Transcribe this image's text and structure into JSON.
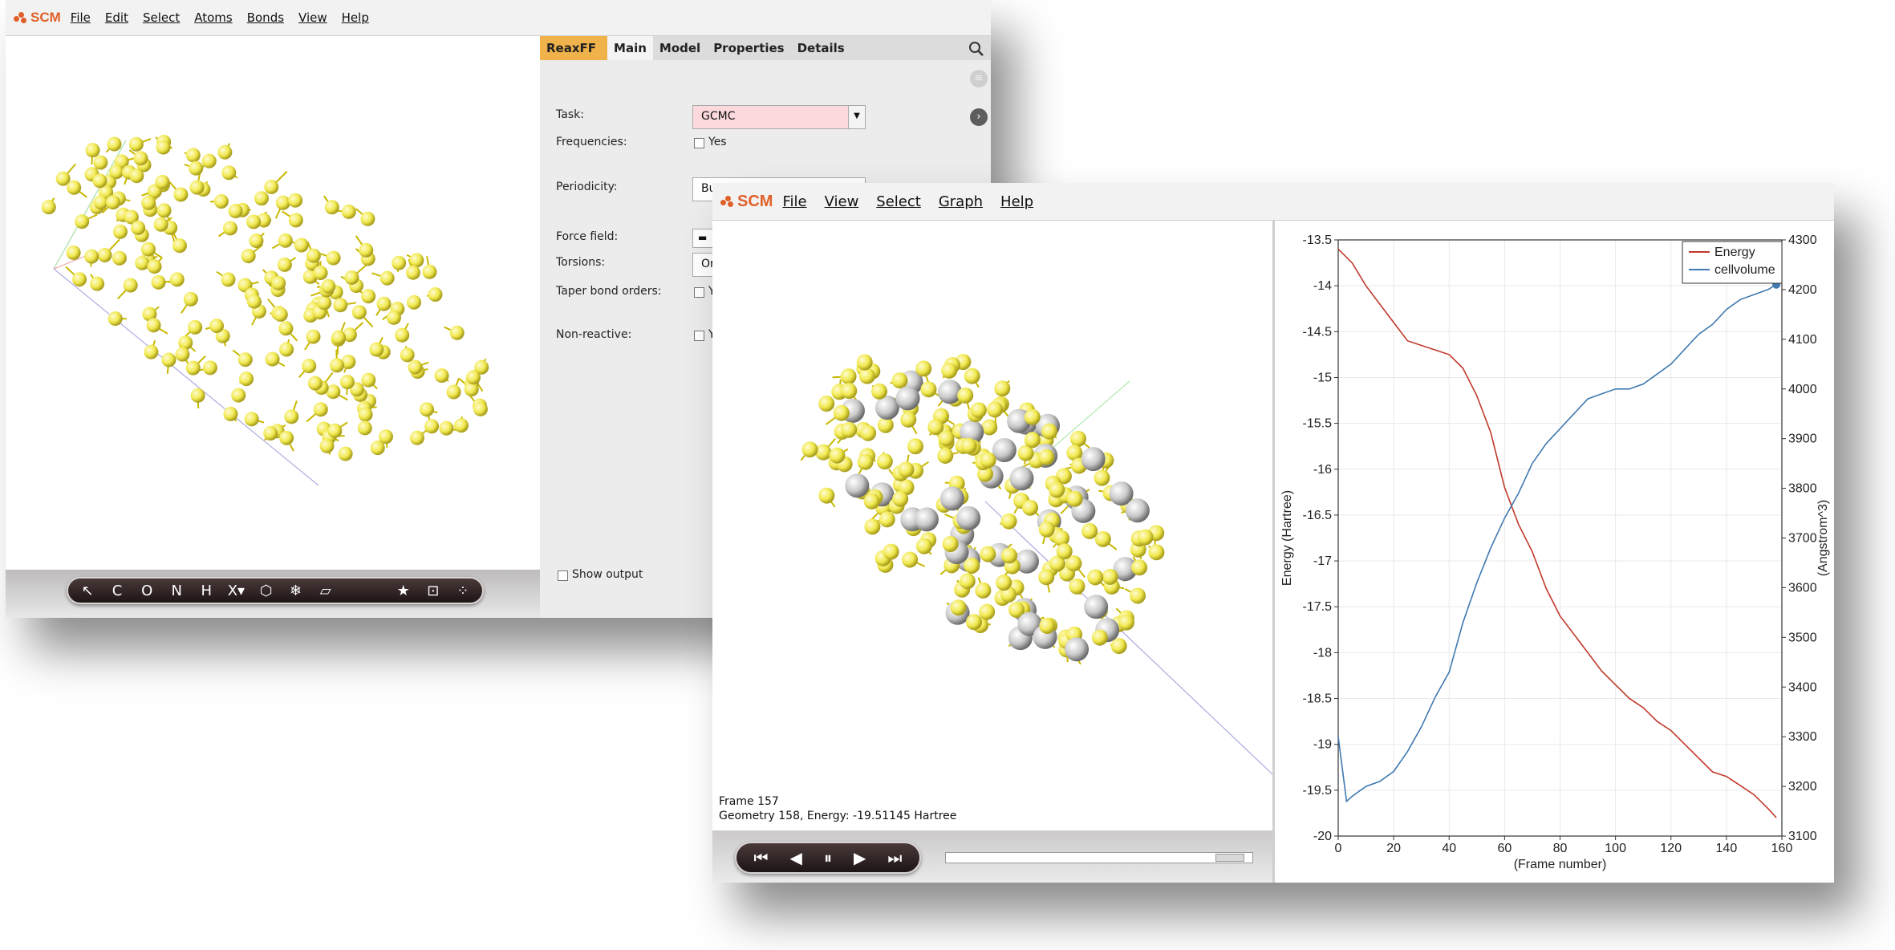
{
  "window1": {
    "logo_text": "SCM",
    "menu": [
      "File",
      "Edit",
      "Select",
      "Atoms",
      "Bonds",
      "View",
      "Help"
    ],
    "toolbar": {
      "tools": [
        {
          "name": "select-tool",
          "glyph": "↖"
        },
        {
          "name": "carbon-tool",
          "glyph": "C"
        },
        {
          "name": "oxygen-tool",
          "glyph": "O"
        },
        {
          "name": "nitrogen-tool",
          "glyph": "N"
        },
        {
          "name": "hydrogen-tool",
          "glyph": "H"
        },
        {
          "name": "halogen-tool",
          "glyph": "X▾"
        },
        {
          "name": "ring-tool",
          "glyph": "⬡"
        },
        {
          "name": "snowflake-tool",
          "glyph": "❄"
        },
        {
          "name": "plane-tool",
          "glyph": "▱"
        },
        {
          "name": "favorite-tool",
          "glyph": "★"
        },
        {
          "name": "region-tool",
          "glyph": "⊡"
        },
        {
          "name": "cluster-tool",
          "glyph": "⁘"
        }
      ]
    },
    "panel": {
      "tabs": [
        "ReaxFF",
        "Main",
        "Model",
        "Properties",
        "Details"
      ],
      "active_tab": "Main",
      "fields": {
        "task_label": "Task:",
        "task_value": "GCMC",
        "frequencies_label": "Frequencies:",
        "frequencies_check": "Yes",
        "periodicity_label": "Periodicity:",
        "periodicity_value": "Bu",
        "force_field_label": "Force field:",
        "torsions_label": "Torsions:",
        "torsions_value": "Or",
        "taper_label": "Taper bond orders:",
        "taper_check": "Ye",
        "nonreactive_label": "Non-reactive:",
        "nonreactive_check": "Ye"
      },
      "show_output_label": "Show output"
    }
  },
  "window2": {
    "logo_text": "SCM",
    "menu": [
      "File",
      "View",
      "Select",
      "Graph",
      "Help"
    ],
    "frame_text": "Frame 157",
    "geometry_text": "Geometry 158, Energy: -19.51145 Hartree",
    "player": {
      "buttons": [
        {
          "name": "first-frame-button",
          "glyph": "⏮"
        },
        {
          "name": "previous-frame-button",
          "glyph": "◀"
        },
        {
          "name": "pause-button",
          "glyph": "⏸"
        },
        {
          "name": "next-frame-button",
          "glyph": "▶"
        },
        {
          "name": "last-frame-button",
          "glyph": "⏭"
        }
      ],
      "slider_fraction": 0.97
    }
  },
  "colors": {
    "energy": "#c0392b",
    "cellvolume": "#3f79b0",
    "atom_s": "#f1e94f",
    "atom_heavy": "#c9c9c9",
    "tab_accent": "#f0b24a"
  },
  "chart_data": {
    "type": "line",
    "xlabel": "(Frame number)",
    "ylabel": "Energy (Hartree)",
    "y2label": "(Angstrom^3)",
    "xlim": [
      0,
      160
    ],
    "ylim": [
      -20,
      -13.5
    ],
    "y2lim": [
      3100,
      4300
    ],
    "x_ticks": [
      0,
      20,
      40,
      60,
      80,
      100,
      120,
      140,
      160
    ],
    "y_ticks": [
      -13.5,
      -14,
      -14.5,
      -15,
      -15.5,
      -16,
      -16.5,
      -17,
      -17.5,
      -18,
      -18.5,
      -19,
      -19.5,
      -20
    ],
    "y2_ticks": [
      4300,
      4200,
      4100,
      4000,
      3900,
      3800,
      3700,
      3600,
      3500,
      3400,
      3300,
      3200,
      3100
    ],
    "grid": true,
    "legend_position": "top-right",
    "series": [
      {
        "name": "Energy",
        "axis": "left",
        "x": [
          0,
          5,
          10,
          15,
          20,
          25,
          30,
          35,
          40,
          45,
          50,
          55,
          60,
          65,
          70,
          75,
          80,
          85,
          90,
          95,
          100,
          105,
          110,
          115,
          120,
          125,
          130,
          135,
          140,
          145,
          150,
          155,
          158
        ],
        "values": [
          -13.6,
          -13.75,
          -14.0,
          -14.2,
          -14.4,
          -14.6,
          -14.65,
          -14.7,
          -14.75,
          -14.9,
          -15.2,
          -15.6,
          -16.2,
          -16.6,
          -16.9,
          -17.3,
          -17.6,
          -17.8,
          -18.0,
          -18.2,
          -18.35,
          -18.5,
          -18.6,
          -18.75,
          -18.85,
          -19.0,
          -19.15,
          -19.3,
          -19.35,
          -19.45,
          -19.55,
          -19.7,
          -19.8
        ]
      },
      {
        "name": "cellvolume",
        "axis": "right",
        "x": [
          0,
          3,
          5,
          10,
          15,
          20,
          25,
          30,
          35,
          40,
          45,
          50,
          55,
          60,
          65,
          70,
          75,
          80,
          85,
          90,
          95,
          100,
          105,
          110,
          115,
          120,
          125,
          130,
          135,
          140,
          145,
          150,
          155,
          158
        ],
        "values": [
          3300,
          3170,
          3180,
          3200,
          3210,
          3230,
          3270,
          3320,
          3380,
          3430,
          3530,
          3610,
          3680,
          3740,
          3790,
          3850,
          3890,
          3920,
          3950,
          3980,
          3990,
          4000,
          4000,
          4010,
          4030,
          4050,
          4080,
          4110,
          4130,
          4160,
          4180,
          4190,
          4200,
          4210
        ]
      }
    ]
  }
}
